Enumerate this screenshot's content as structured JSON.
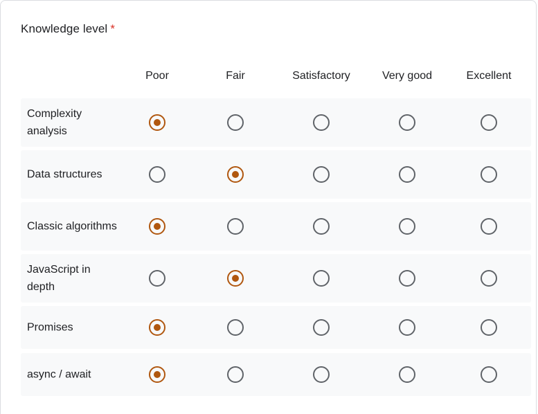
{
  "question": {
    "title": "Knowledge level",
    "required_mark": "*"
  },
  "accent_color": "#b0570f",
  "columns": [
    "Poor",
    "Fair",
    "Satisfactory",
    "Very good",
    "Excellent"
  ],
  "rows": [
    {
      "label": "Complexity analysis",
      "selected": 0
    },
    {
      "label": "Data structures",
      "selected": 1
    },
    {
      "label": "Classic algorithms",
      "selected": 0
    },
    {
      "label": "JavaScript in depth",
      "selected": 1
    },
    {
      "label": "Promises",
      "selected": 0
    },
    {
      "label": "async / await",
      "selected": 0
    }
  ]
}
